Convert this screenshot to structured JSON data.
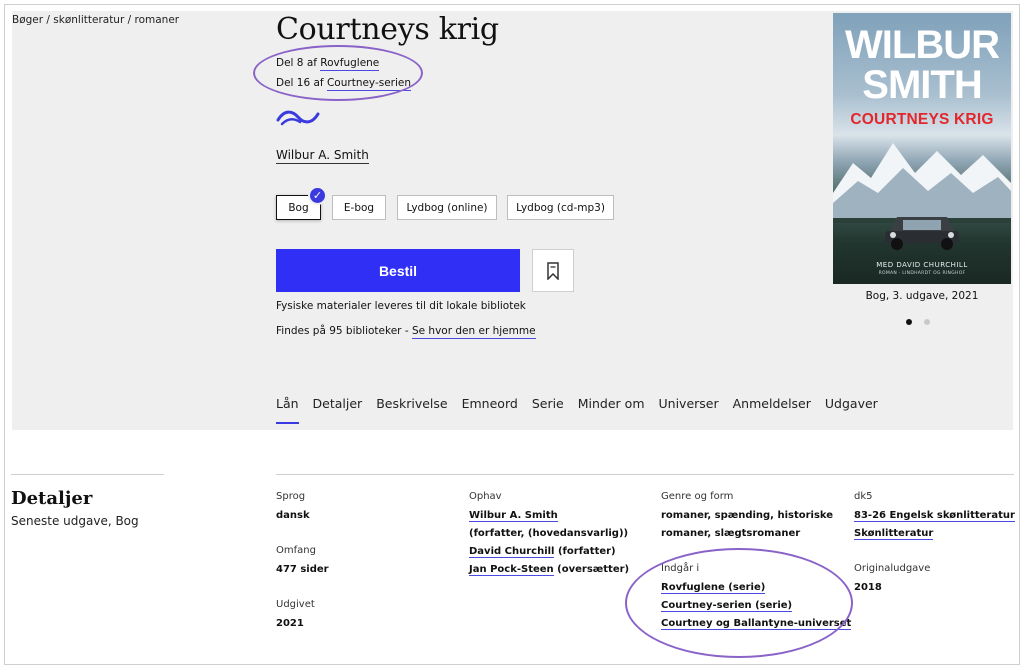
{
  "breadcrumb": "Bøger / skønlitteratur / romaner",
  "title": "Courtneys krig",
  "series": [
    {
      "prefix": "Del 8 af ",
      "link": "Rovfuglene"
    },
    {
      "prefix": "Del 16 af ",
      "link": "Courtney-serien"
    }
  ],
  "author": "Wilbur A. Smith",
  "formats": [
    "Bog",
    "E-bog",
    "Lydbog (online)",
    "Lydbog (cd-mp3)"
  ],
  "selected_format": "Bog",
  "order_label": "Bestil",
  "info_physical": "Fysiske materialer leveres til dit lokale bibliotek",
  "availability": {
    "prefix": "Findes på 95 biblioteker - ",
    "link": "Se hvor den er hjemme"
  },
  "cover": {
    "author_line1": "WILBUR",
    "author_line2": "SMITH",
    "title": "COURTNEYS KRIG",
    "subtitle": "MED DAVID CHURCHILL",
    "publisher_line": "ROMAN · LINDHARDT OG RINGHOF",
    "caption": "Bog, 3. udgave, 2021"
  },
  "tabs": [
    "Lån",
    "Detaljer",
    "Beskrivelse",
    "Emneord",
    "Serie",
    "Minder om",
    "Universer",
    "Anmeldelser",
    "Udgaver"
  ],
  "active_tab": "Lån",
  "details": {
    "heading": "Detaljer",
    "subheading": "Seneste udgave, Bog",
    "sprog_label": "Sprog",
    "sprog_value": "dansk",
    "omfang_label": "Omfang",
    "omfang_value": "477 sider",
    "udgivet_label": "Udgivet",
    "udgivet_value": "2021",
    "ophav_label": "Ophav",
    "ophav": [
      {
        "link": "Wilbur A. Smith",
        "text": ""
      },
      {
        "link": "",
        "text": "(forfatter, (hovedansvarlig))"
      },
      {
        "link": "David Churchill",
        "text": " (forfatter)"
      },
      {
        "link": "Jan Pock-Steen",
        "text": " (oversætter)"
      }
    ],
    "genre_label": "Genre og form",
    "genre_line1": "romaner, spænding, historiske",
    "genre_line2": "romaner, slægtsromaner",
    "indgaar_label": "Indgår i",
    "indgaar": [
      "Rovfuglene (serie)",
      "Courtney-serien (serie)",
      "Courtney og Ballantyne-universet"
    ],
    "dk5_label": "dk5",
    "dk5": [
      "83-26 Engelsk skønlitteratur",
      "Skønlitteratur"
    ],
    "original_label": "Originaludgave",
    "original_value": "2018"
  },
  "colors": {
    "accent": "#2f2ff5",
    "annotation": "#8a63c8",
    "cover_title": "#e3262b"
  }
}
